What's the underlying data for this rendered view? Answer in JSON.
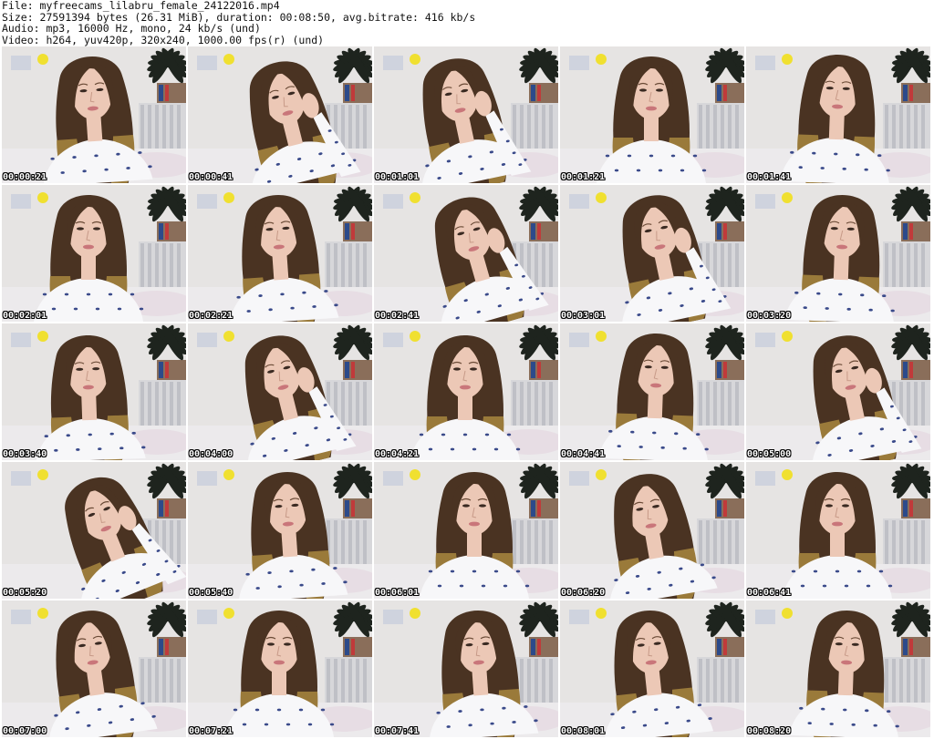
{
  "header": {
    "file": "File: myfreecams_lilabru_female_24122016.mp4",
    "size": "Size: 27591394 bytes (26.31 MiB), duration: 00:08:50, avg.bitrate: 416 kb/s",
    "audio": "Audio: mp3, 16000 Hz, mono, 24 kb/s (und)",
    "video": "Video: h264, yuv420p, 320x240, 1000.00 fps(r) (und)"
  },
  "thumbnails": [
    {
      "timestamp": "00:00:21"
    },
    {
      "timestamp": "00:00:41"
    },
    {
      "timestamp": "00:01:01"
    },
    {
      "timestamp": "00:01:21"
    },
    {
      "timestamp": "00:01:41"
    },
    {
      "timestamp": "00:02:01"
    },
    {
      "timestamp": "00:02:21"
    },
    {
      "timestamp": "00:02:41"
    },
    {
      "timestamp": "00:03:01"
    },
    {
      "timestamp": "00:03:20"
    },
    {
      "timestamp": "00:03:40"
    },
    {
      "timestamp": "00:04:00"
    },
    {
      "timestamp": "00:04:21"
    },
    {
      "timestamp": "00:04:41"
    },
    {
      "timestamp": "00:05:00"
    },
    {
      "timestamp": "00:05:20"
    },
    {
      "timestamp": "00:05:40"
    },
    {
      "timestamp": "00:06:01"
    },
    {
      "timestamp": "00:06:20"
    },
    {
      "timestamp": "00:06:41"
    },
    {
      "timestamp": "00:07:00"
    },
    {
      "timestamp": "00:07:21"
    },
    {
      "timestamp": "00:07:41"
    },
    {
      "timestamp": "00:08:01"
    },
    {
      "timestamp": "00:08:20"
    }
  ],
  "colors": {
    "wall": "#e6e4e3",
    "hair_dark": "#4a3322",
    "hair_light": "#9a7a3a",
    "skin": "#ecc8b6",
    "shirt": "#f7f7f9",
    "shirt_dots": "#3a4a8a",
    "plant": "#1e241e",
    "radiator": "#d7d7da"
  }
}
